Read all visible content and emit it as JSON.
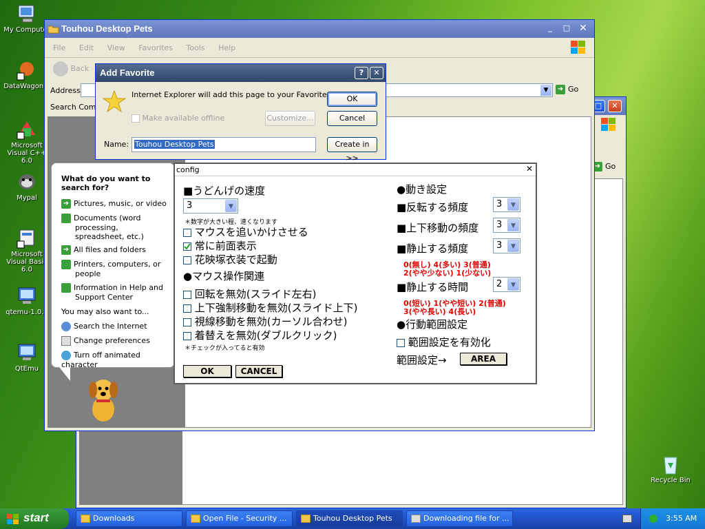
{
  "desktop": {
    "icons": [
      {
        "label": "My Computer",
        "icon": "my-computer-icon"
      },
      {
        "label": "DataWagon...",
        "icon": "datawagon-icon"
      },
      {
        "label": "Microsoft Visual C++ 6.0",
        "icon": "visual-cpp-icon"
      },
      {
        "label": "Mypal",
        "icon": "mypal-icon"
      },
      {
        "label": "Microsoft Visual Basic 6.0",
        "icon": "visual-basic-icon"
      },
      {
        "label": "qtemu-1.0.5",
        "icon": "qtemu-icon"
      },
      {
        "label": "QtEmu",
        "icon": "qtemu-icon"
      },
      {
        "label": "Recycle Bin",
        "icon": "recycle-bin-icon"
      }
    ]
  },
  "explorer": {
    "title": "Touhou Desktop Pets",
    "menu": [
      "File",
      "Edit",
      "View",
      "Favorites",
      "Tools",
      "Help"
    ],
    "back_label": "Back",
    "address_label": "Address",
    "go_label": "Go",
    "search_comp_label": "Search Comp",
    "search_panel": {
      "heading": "What do you want to search for?",
      "options": [
        "Pictures, music, or video",
        "Documents (word processing, spreadsheet, etc.)",
        "All files and folders",
        "Printers, computers, or people",
        "Information in Help and Support Center"
      ],
      "also_label": "You may also want to...",
      "also_options": [
        "Search the Internet",
        "Change preferences",
        "Turn off animated character"
      ]
    }
  },
  "back_window": {
    "go_label": "Go"
  },
  "add_favorite": {
    "title": "Add Favorite",
    "message": "Internet Explorer will add this page to your Favorites list.",
    "offline_label": "Make available offline",
    "customize_label": "Customize...",
    "ok_label": "OK",
    "cancel_label": "Cancel",
    "name_label": "Name:",
    "name_value": "Touhou Desktop Pets",
    "create_in_label": "Create in >>"
  },
  "config": {
    "title": "config",
    "udonge_speed": "■うどんげの速度",
    "speed_value": "3",
    "speed_note": "＊数字が大きい程、速くなります",
    "chase_mouse": "マウスを追いかけさせる",
    "always_front": "常に前面表示",
    "kaeidzuka": "花映塚衣装で起動",
    "mouse_ops": "●マウス操作関連",
    "disable_rotate": "回転を無効(スライド左右)",
    "disable_updown": "上下強制移動を無効(スライド上下)",
    "disable_gaze": "視線移動を無効(カーソル合わせ)",
    "disable_dress": "着替えを無効(ダブルクリック)",
    "check_note": "＊チェックが入ってると有効",
    "ok_label": "OK",
    "cancel_label": "CANCEL",
    "motion_settings": "●動き設定",
    "flip_freq": "■反転する頻度",
    "flip_value": "3",
    "updown_freq": "■上下移動の頻度",
    "updown_value": "3",
    "stop_freq": "■静止する頻度",
    "stop_value": "3",
    "freq_legend_1": "0(無し) 4(多い) 3(普通)",
    "freq_legend_2": "2(やや少ない) 1(少ない)",
    "stop_time": "■静止する時間",
    "stop_time_value": "2",
    "time_legend_1": "0(短い) 1(やや短い) 2(普通)",
    "time_legend_2": "3(やや長い) 4(長い)",
    "range_settings": "●行動範囲設定",
    "enable_range": "範囲設定を有効化",
    "range_label": "範囲設定→",
    "area_label": "AREA"
  },
  "taskbar": {
    "start_label": "start",
    "tasks": [
      "Downloads",
      "Open File - Security ...",
      "Touhou Desktop Pets",
      "Downloading file for ..."
    ],
    "clock": "3:55 AM"
  }
}
